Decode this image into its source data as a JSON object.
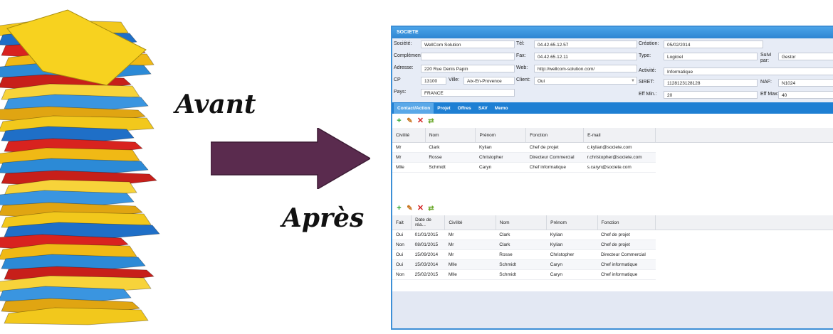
{
  "captions": {
    "before": "Avant",
    "after": "Après"
  },
  "colors": {
    "arrow": "#5a2b4e",
    "window_border": "#3d8fd6",
    "tab_bar": "#1e7fd3",
    "add": "#2aa52a",
    "delete": "#d22020"
  },
  "window": {
    "title": "SOCIETE",
    "form": {
      "societe_label": "Société:",
      "societe_value": "WellCom Solution",
      "complement_label": "Complément:",
      "complement_value": "",
      "adresse_label": "Adresse:",
      "adresse_value": "220 Rue Denis Papin",
      "cp_label": "CP",
      "cp_value": "13100",
      "ville_label": "Ville:",
      "ville_value": "Aix-En-Provence",
      "pays_label": "Pays:",
      "pays_value": "FRANCE",
      "tel_label": "Tél:",
      "tel_value": "04.42.65.12.57",
      "fax_label": "Fax:",
      "fax_value": "04.42.65.12.11",
      "web_label": "Web:",
      "web_value": "http://wellcom-solution.com/",
      "client_label": "Client:",
      "client_value": "Oui",
      "creation_label": "Création:",
      "creation_value": "05/02/2014",
      "type_label": "Type:",
      "type_value": "Logiciel",
      "suivi_label": "Suivi par:",
      "suivi_value": "Gestor",
      "activite_label": "Activité:",
      "activite_value": "Informatique",
      "siret_label": "SIRET:",
      "siret_value": "1128123128128",
      "naf_label": "NAF:",
      "naf_value": "N1024",
      "effmin_label": "Eff Min.:",
      "effmin_value": "20",
      "effmax_label": "Eff Max:",
      "effmax_value": "40"
    },
    "tabs": [
      "Contact/Action",
      "Projet",
      "Offres",
      "SAV",
      "Memo"
    ],
    "toolbar_icons": [
      "add-icon",
      "edit-icon",
      "delete-icon",
      "refresh-icon"
    ],
    "contacts": {
      "headers": [
        "Civilité",
        "Nom",
        "Prénom",
        "Fonction",
        "E-mail"
      ],
      "rows": [
        [
          "Mr",
          "Clark",
          "Kylian",
          "Chef de projet",
          "c.kylian@societe.com"
        ],
        [
          "Mr",
          "Rosse",
          "Christopher",
          "Directeur Commercial",
          "r.christopher@societe.com"
        ],
        [
          "Mlle",
          "Schmidt",
          "Caryn",
          "Chef informatique",
          "s.caryn@societe.com"
        ]
      ]
    },
    "actions": {
      "headers": [
        "Fait",
        "Date de réa...",
        "Civilité",
        "Nom",
        "Prénom",
        "Fonction"
      ],
      "rows": [
        [
          "Oui",
          "01/01/2015",
          "Mr",
          "Clark",
          "Kylian",
          "Chef de projet"
        ],
        [
          "Non",
          "08/01/2015",
          "Mr",
          "Clark",
          "Kylian",
          "Chef de projet"
        ],
        [
          "Oui",
          "15/09/2014",
          "Mr",
          "Rosse",
          "Christopher",
          "Directeur Commercial"
        ],
        [
          "Oui",
          "15/03/2014",
          "Mlle",
          "Schmidt",
          "Caryn",
          "Chef informatique"
        ],
        [
          "Non",
          "25/02/2015",
          "Mlle",
          "Schmidt",
          "Caryn",
          "Chef informatique"
        ]
      ]
    }
  }
}
